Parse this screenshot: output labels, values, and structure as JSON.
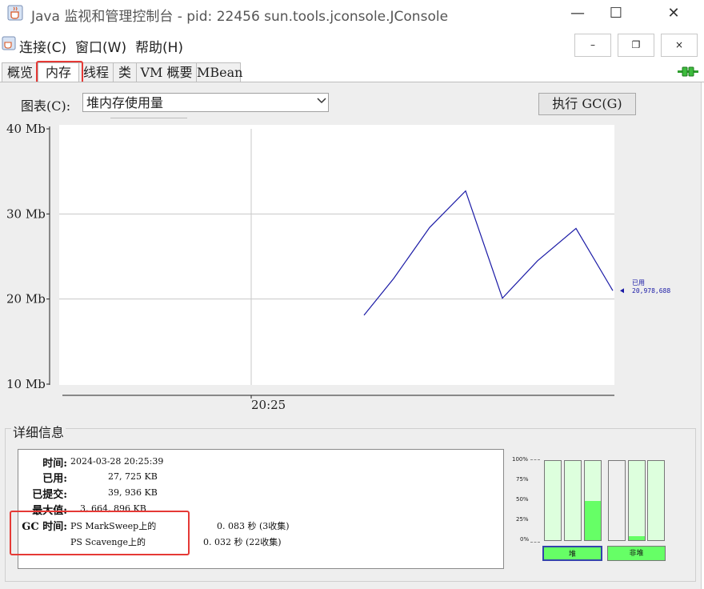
{
  "window": {
    "title": "Java 监视和管理控制台 - pid: 22456 sun.tools.jconsole.JConsole",
    "minimize": "—",
    "maximize": "☐",
    "close": "✕"
  },
  "menu": {
    "items": [
      "连接(C)",
      "窗口(W)",
      "帮助(H)"
    ],
    "mdi_minimize": "–",
    "mdi_restore": "❐",
    "mdi_close": "×"
  },
  "tabs": [
    "概览",
    "内存",
    "线程",
    "类",
    "VM 概要",
    "MBean"
  ],
  "active_tab": "内存",
  "toolbar": {
    "chart_label": "图表(C):",
    "chart_select_value": "堆内存使用量",
    "gc_button": "执行 GC(G)"
  },
  "chart_data": {
    "type": "line",
    "title": "",
    "xlabel": "",
    "ylabel": "",
    "x_tick_labels": [
      "20:25"
    ],
    "y_tick_labels": [
      "40 Mb",
      "30 Mb",
      "20 Mb",
      "10 Mb"
    ],
    "ylim": [
      10,
      40
    ],
    "grid": true,
    "series": [
      {
        "name": "已用",
        "color": "#1a1aa6",
        "values": [
          18.1,
          22.4,
          28.4,
          32.7,
          20.1,
          24.5,
          28.3,
          20.98
        ]
      }
    ],
    "current_label": "已用",
    "current_value": "20,978,688"
  },
  "details": {
    "title": "详细信息",
    "rows": [
      {
        "label": "时间:",
        "value": "2024-03-28 20:25:39"
      },
      {
        "label": "已用:",
        "value": "27, 725 KB"
      },
      {
        "label": "已提交:",
        "value": "39, 936 KB"
      },
      {
        "label": "最大值:",
        "value": "3, 664, 896 KB"
      }
    ],
    "gc_label": "GC 时间:",
    "gc": [
      {
        "name": "PS MarkSweep上的",
        "time": "0. 083 秒 (3收集)"
      },
      {
        "name": "PS Scavenge上的",
        "time": "0. 032 秒 (22收集)"
      }
    ]
  },
  "bars": {
    "pct_labels": [
      "100%",
      "75%",
      "50%",
      "25%",
      "0%"
    ],
    "heap": {
      "label": "堆",
      "fills": [
        0,
        0,
        0.5
      ]
    },
    "nonheap": {
      "label": "非堆",
      "fills": [
        0,
        0.05,
        0
      ]
    }
  },
  "colors": {
    "series": "#1a1aa6",
    "bar_fill": "#66ff66",
    "highlight": "#e53935"
  }
}
